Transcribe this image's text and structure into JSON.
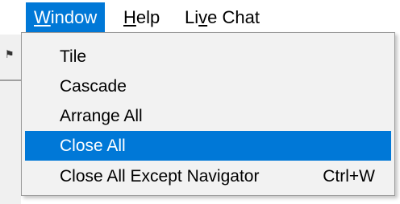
{
  "menubar": {
    "items": [
      {
        "label_accel": "W",
        "label_rest": "indow"
      },
      {
        "label_accel": "H",
        "label_rest": "elp"
      },
      {
        "label_pre": "Li",
        "label_accel": "v",
        "label_rest": "e Chat"
      }
    ]
  },
  "dropdown": {
    "items": [
      {
        "label": "Tile",
        "shortcut": ""
      },
      {
        "label": "Cascade",
        "shortcut": ""
      },
      {
        "label": "Arrange All",
        "shortcut": ""
      },
      {
        "label": "Close All",
        "shortcut": ""
      },
      {
        "label": "Close All Except Navigator",
        "shortcut": "Ctrl+W"
      }
    ],
    "highlighted": "Close All"
  },
  "colors": {
    "highlight": "#0078d7",
    "menu_bg": "#f2f2f2",
    "border": "#999999"
  }
}
